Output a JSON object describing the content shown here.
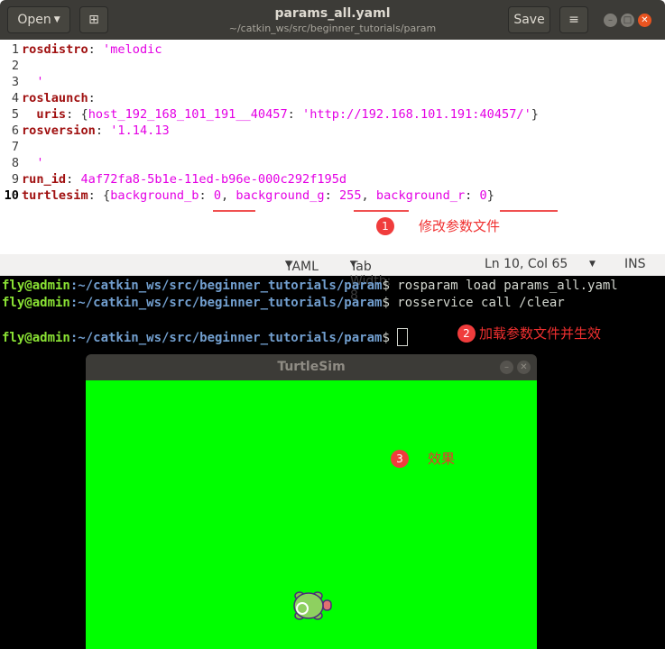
{
  "editor": {
    "open_label": "Open",
    "save_label": "Save",
    "title": "params_all.yaml",
    "subtitle": "~/catkin_ws/src/beginner_tutorials/param",
    "lines": [
      {
        "n": "1",
        "parts": [
          [
            "k",
            "rosdistro"
          ],
          [
            "p",
            ": "
          ],
          [
            "v",
            "'melodic"
          ]
        ]
      },
      {
        "n": "2",
        "parts": []
      },
      {
        "n": "3",
        "parts": [
          [
            "v",
            "  '"
          ]
        ]
      },
      {
        "n": "4",
        "parts": [
          [
            "k",
            "roslaunch"
          ],
          [
            "p",
            ":"
          ]
        ]
      },
      {
        "n": "5",
        "parts": [
          [
            "p",
            "  "
          ],
          [
            "k",
            "uris"
          ],
          [
            "p",
            ": {"
          ],
          [
            "v",
            "host_192_168_101_191__40457"
          ],
          [
            "p",
            ": "
          ],
          [
            "v",
            "'http://192.168.101.191:40457/'"
          ],
          [
            "p",
            "}"
          ]
        ]
      },
      {
        "n": "6",
        "parts": [
          [
            "k",
            "rosversion"
          ],
          [
            "p",
            ": "
          ],
          [
            "v",
            "'1.14.13"
          ]
        ]
      },
      {
        "n": "7",
        "parts": []
      },
      {
        "n": "8",
        "parts": [
          [
            "v",
            "  '"
          ]
        ]
      },
      {
        "n": "9",
        "parts": [
          [
            "k",
            "run_id"
          ],
          [
            "p",
            ": "
          ],
          [
            "v",
            "4af72fa8-5b1e-11ed-b96e-000c292f195d"
          ]
        ]
      },
      {
        "n": "10",
        "parts": [
          [
            "k",
            "turtlesim"
          ],
          [
            "p",
            ": {"
          ],
          [
            "v",
            "background_b"
          ],
          [
            "p",
            ": "
          ],
          [
            "v",
            "0"
          ],
          [
            "p",
            ", "
          ],
          [
            "v",
            "background_g"
          ],
          [
            "p",
            ": "
          ],
          [
            "v",
            "255"
          ],
          [
            "p",
            ", "
          ],
          [
            "v",
            "background_r"
          ],
          [
            "p",
            ": "
          ],
          [
            "v",
            "0"
          ],
          [
            "p",
            "}"
          ]
        ]
      }
    ],
    "status": {
      "language": "YAML",
      "tab_width": "Tab Width: 8",
      "position": "Ln 10, Col 65",
      "mode": "INS"
    }
  },
  "annotations": [
    {
      "num": "1",
      "text": "修改参数文件"
    },
    {
      "num": "2",
      "text": "加载参数文件并生效"
    },
    {
      "num": "3",
      "text": "效果"
    }
  ],
  "terminal": {
    "user": "fly@admin",
    "path": ":~/catkin_ws/src/beginner_tutorials/param",
    "prompt": "$ ",
    "commands": [
      "rosparam load params_all.yaml",
      "rosservice call /clear",
      ""
    ]
  },
  "turtlesim": {
    "title": "TurtleSim",
    "background": "#00ff00"
  }
}
